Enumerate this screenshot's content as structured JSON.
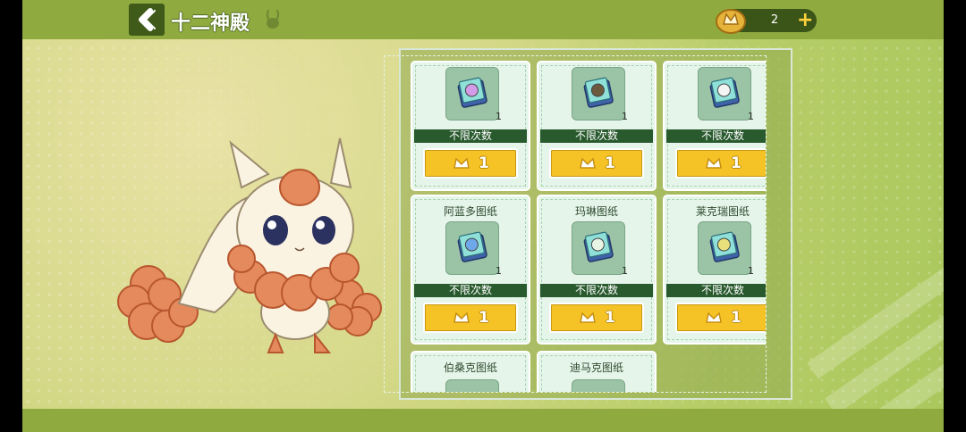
{
  "header": {
    "title": "十二神殿",
    "currency_amount": "2",
    "add_label": "+"
  },
  "shop": {
    "items": [
      {
        "name": "",
        "qty": "1",
        "limit": "不限次数",
        "price": "1",
        "color": "#d49be8"
      },
      {
        "name": "",
        "qty": "1",
        "limit": "不限次数",
        "price": "1",
        "color": "#6b5a3e"
      },
      {
        "name": "",
        "qty": "1",
        "limit": "不限次数",
        "price": "1",
        "color": "#f4f4f4"
      },
      {
        "name": "阿蓝多图纸",
        "qty": "1",
        "limit": "不限次数",
        "price": "1",
        "color": "#6fa8e8"
      },
      {
        "name": "玛琳图纸",
        "qty": "1",
        "limit": "不限次数",
        "price": "1",
        "color": "#e8f4e4"
      },
      {
        "name": "莱克瑞图纸",
        "qty": "1",
        "limit": "不限次数",
        "price": "1",
        "color": "#e8e07a"
      },
      {
        "name": "伯桑克图纸",
        "qty": "",
        "limit": "",
        "price": "",
        "color": "#9bc3a5"
      },
      {
        "name": "迪马克图纸",
        "qty": "",
        "limit": "",
        "price": "",
        "color": "#9bc3a5"
      }
    ]
  },
  "colors": {
    "bar": "#8faa3e",
    "buy_button": "#f6c327",
    "limit_band": "#295a2e"
  }
}
